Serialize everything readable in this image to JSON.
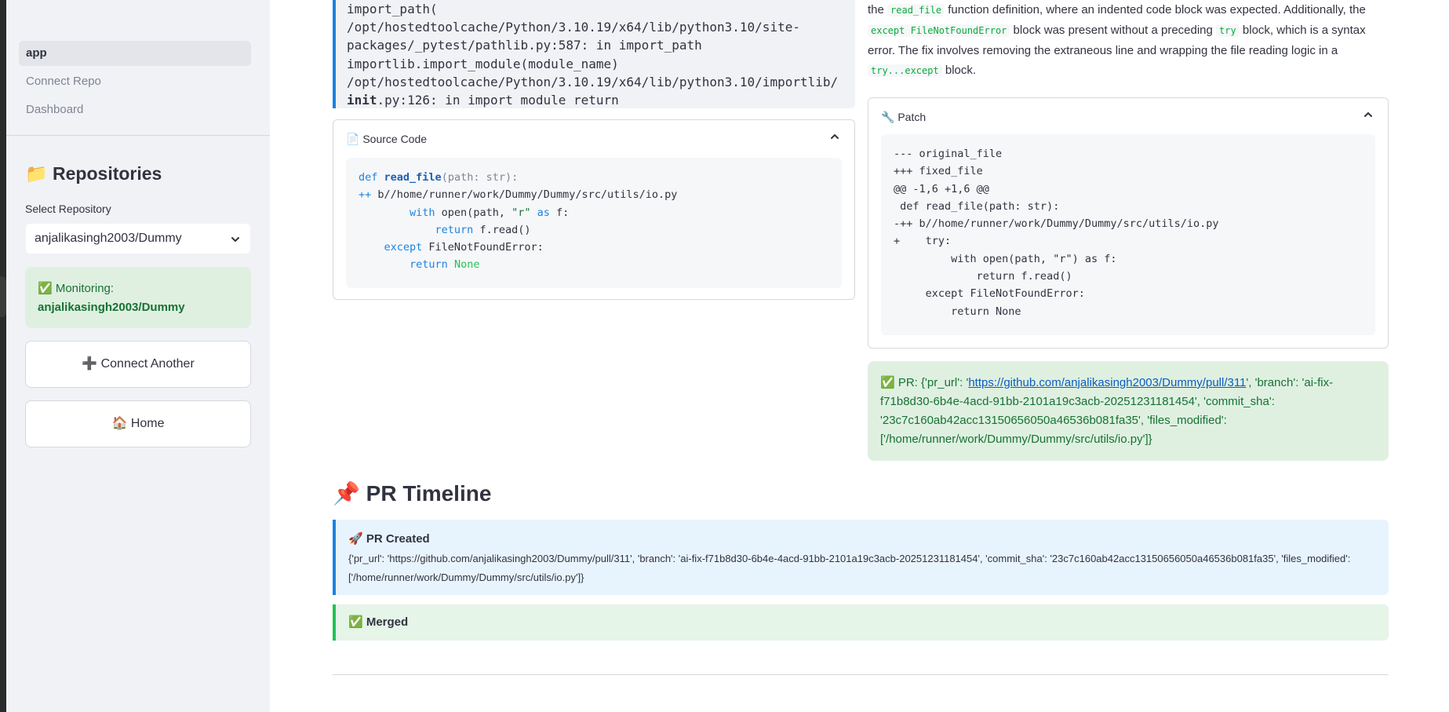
{
  "sidebar": {
    "nav": [
      {
        "label": "app",
        "active": true
      },
      {
        "label": "Connect Repo",
        "active": false
      },
      {
        "label": "Dashboard",
        "active": false
      }
    ],
    "repositories_title": "📁 Repositories",
    "select_label": "Select Repository",
    "select_value": "anjalikasingh2003/Dummy",
    "monitoring_prefix": "✅ Monitoring:",
    "monitoring_repo": "anjalikasingh2003/Dummy",
    "connect_another_label": "➕ Connect Another",
    "home_label": "🏠 Home"
  },
  "traceback_lines": [
    "import_path(",
    "/opt/hostedtoolcache/Python/3.10.19/x64/lib/python3.10/site-",
    "packages/_pytest/pathlib.py:587: in import_path",
    "importlib.import_module(module_name)",
    "/opt/hostedtoolcache/Python/3.10.19/x64/lib/python3.10/importlib/"
  ],
  "traceback_last": {
    "bold": "init",
    "rest": ".py:126: in import module return"
  },
  "source_code": {
    "header": "📄 Source Code",
    "lines": {
      "l1_def": "def",
      "l1_name": "read_file",
      "l1_rest": "(path: str):",
      "l2_plus": "++",
      "l2_path": " b//home/runner/work/Dummy/Dummy/src/utils/io.py",
      "l3_with": "with",
      "l3_mid": " open(path, ",
      "l3_str": "\"r\"",
      "l3_as": " as",
      "l3_end": " f:",
      "l4_return": "return",
      "l4_rest": " f.read()",
      "l5_except": "except",
      "l5_rest": " FileNotFoundError:",
      "l6_return": "return",
      "l6_none": " None"
    }
  },
  "summary": {
    "p1": "the ",
    "c1": "read_file",
    "p2": " function definition, where an indented code block was expected. Additionally, the",
    "c2": "except FileNotFoundError",
    "p3": " block was present without a preceding ",
    "c3": "try",
    "p4": " block, which is a syntax",
    "p5": "error. The fix involves removing the extraneous line and wrapping the file reading logic in a",
    "c4": "try...except",
    "p6": " block."
  },
  "patch": {
    "header": "🔧 Patch",
    "text": "--- original_file\n+++ fixed_file\n@@ -1,6 +1,6 @@\n def read_file(path: str):\n-++ b//home/runner/work/Dummy/Dummy/src/utils/io.py\n+    try:\n         with open(path, \"r\") as f:\n             return f.read()\n     except FileNotFoundError:\n         return None"
  },
  "pr_result": {
    "prefix": "✅ PR: {'pr_url': '",
    "url": "https://github.com/anjalikasingh2003/Dummy/pull/311",
    "suffix": "', 'branch': 'ai-fix-f71b8d30-6b4e-4acd-91bb-2101a19c3acb-20251231181454', 'commit_sha': '23c7c160ab42acc13150656050a46536b081fa35', 'files_modified': ['/home/runner/work/Dummy/Dummy/src/utils/io.py']}"
  },
  "timeline": {
    "title": "📌 PR Timeline",
    "created_title": "🚀 PR Created",
    "created_body": "{'pr_url': 'https://github.com/anjalikasingh2003/Dummy/pull/311', 'branch': 'ai-fix-f71b8d30-6b4e-4acd-91bb-2101a19c3acb-20251231181454', 'commit_sha': '23c7c160ab42acc13150656050a46536b081fa35', 'files_modified': ['/home/runner/work/Dummy/Dummy/src/utils/io.py']}",
    "merged_title": "✅ Merged"
  }
}
